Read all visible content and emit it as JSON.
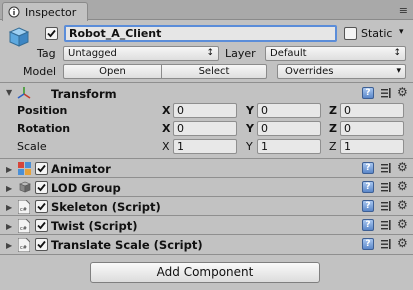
{
  "tab": {
    "title": "Inspector",
    "menu_glyph": "≡"
  },
  "header": {
    "object_name": "Robot_A_Client",
    "active": true,
    "static_label": "Static",
    "static_arrow": "▾",
    "tag_label": "Tag",
    "tag_value": "Untagged",
    "layer_label": "Layer",
    "layer_value": "Default",
    "model_label": "Model",
    "open_label": "Open",
    "select_label": "Select",
    "overrides_value": "Overrides",
    "dropdown_arrow": "↕"
  },
  "transform": {
    "title": "Transform",
    "fold_glyph": "▼",
    "rows": [
      {
        "label": "Position",
        "x": "0",
        "y": "0",
        "z": "0"
      },
      {
        "label": "Rotation",
        "x": "0",
        "y": "0",
        "z": "0"
      },
      {
        "label": "Scale",
        "x": "1",
        "y": "1",
        "z": "1"
      }
    ],
    "axes": {
      "x": "X",
      "y": "Y",
      "z": "Z"
    }
  },
  "components": [
    {
      "title": "Animator",
      "enabled": true
    },
    {
      "title": "LOD Group",
      "enabled": true
    },
    {
      "title": "Skeleton (Script)",
      "enabled": true
    },
    {
      "title": "Twist (Script)",
      "enabled": true
    },
    {
      "title": "Translate Scale (Script)",
      "enabled": true
    }
  ],
  "collapsed_glyph": "▶",
  "help_glyph": "?",
  "gear_glyph": "⚙",
  "script_icon_text": "c#",
  "add_component_label": "Add Component",
  "colors": {
    "background": "#c2c2c2",
    "field_focus": "#5b8dd9",
    "help_icon": "#5b87c9"
  }
}
